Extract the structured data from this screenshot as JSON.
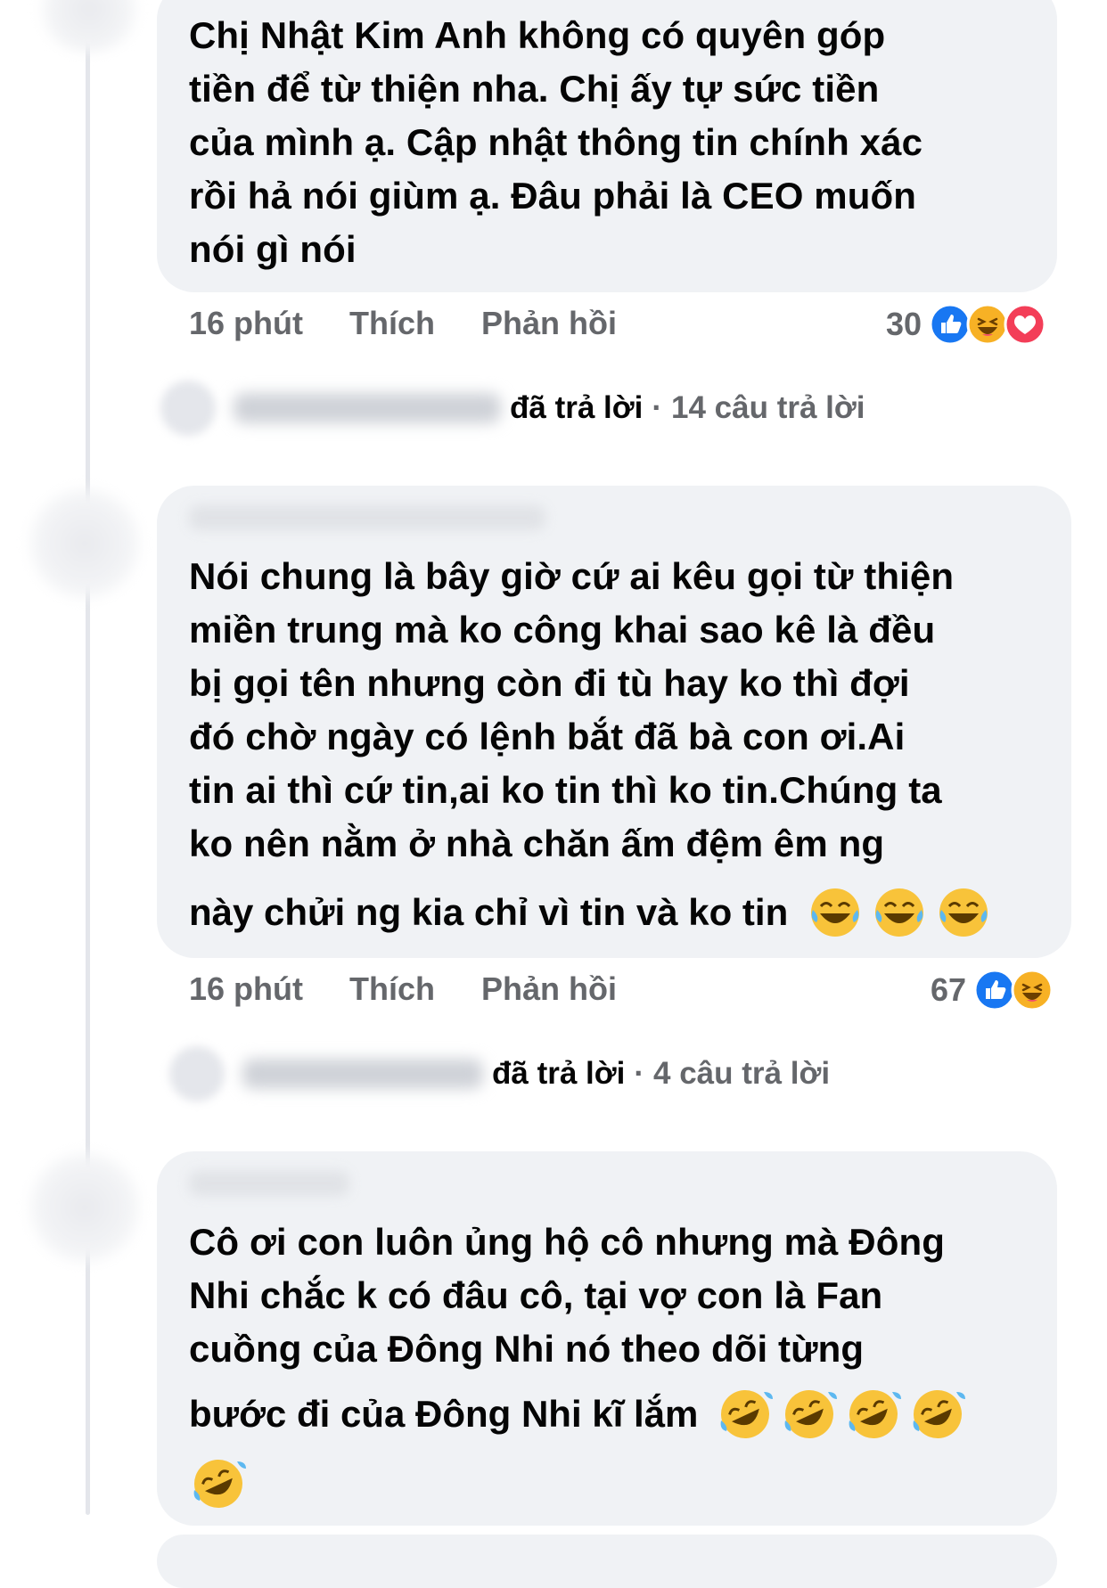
{
  "comments": [
    {
      "text": "Chị Nhật Kim Anh không có quyên góp\ntiền để từ thiện nha. Chị ấy tự sức tiền\ncủa mình ạ. Cập nhật thông tin chính xác\nrồi hả nói giùm ạ. Đâu phải là CEO muốn\nnói gì nói",
      "time": "16 phút",
      "like_label": "Thích",
      "reply_label": "Phản hồi",
      "reaction_count": "30",
      "reactions": [
        "like-icon",
        "haha-icon",
        "love-icon"
      ],
      "replies_replied": "đã trả lời",
      "replies_sep": "·",
      "replies_count": "14 câu trả lời"
    },
    {
      "text": "Nói chung là bây giờ cứ ai kêu gọi từ thiện\nmiền trung mà ko công khai sao kê là đều\nbị gọi tên nhưng còn đi tù hay ko thì đợi\nđó chờ ngày có lệnh bắt đã bà con ơi.Ai\ntin ai thì cứ tin,ai ko tin thì ko tin.Chúng ta\nko nên nằm ở nhà chăn ấm đệm êm ng",
      "text_last": "này chửi ng kia chỉ vì tin và ko tin",
      "emojis": [
        "tears-of-joy-icon",
        "tears-of-joy-icon",
        "tears-of-joy-icon"
      ],
      "time": "16 phút",
      "like_label": "Thích",
      "reply_label": "Phản hồi",
      "reaction_count": "67",
      "reactions": [
        "like-icon",
        "haha-icon"
      ],
      "replies_replied": "đã trả lời",
      "replies_sep": "·",
      "replies_count": "4 câu trả lời"
    },
    {
      "text": "Cô ơi con luôn ủng hộ cô nhưng mà Đông\nNhi chắc k có đâu cô, tại vợ con là Fan\ncuồng của Đông Nhi nó theo dõi từng",
      "text_last": "bước đi của Đông Nhi kĩ lắm",
      "emojis": [
        "rofl-icon",
        "rofl-icon",
        "rofl-icon",
        "rofl-icon",
        "rofl-icon"
      ]
    }
  ],
  "colors": {
    "bubble": "#f0f2f5",
    "meta_text": "#65676b",
    "like_blue": "#1877f2",
    "love_red": "#f33e58",
    "haha_yellow": "#f7b125"
  }
}
